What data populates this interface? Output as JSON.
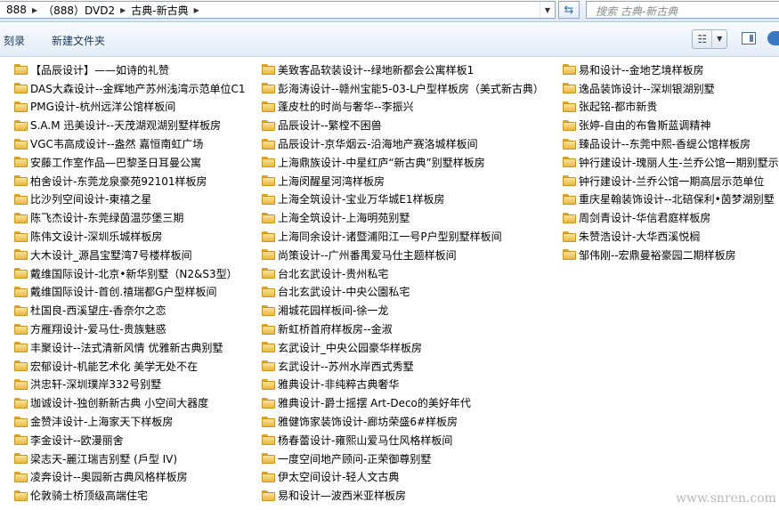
{
  "address": {
    "crumbs": [
      "888",
      "（888）DVD2",
      "古典-新古典"
    ],
    "search_placeholder": "搜索 古典-新古典"
  },
  "toolbar": {
    "burn_label": "刻录",
    "new_folder_label": "新建文件夹"
  },
  "watermark": "www.snren.com",
  "columns": [
    [
      "【品辰设计】——如诗的礼赞",
      "DAS大森设计--金辉地产苏州浅湾示范单位C1",
      "PMG设计-杭州远洋公馆样板间",
      "S.A.M 迅美设计--天茂湖观湖别墅样板房",
      "VGC韦高成设计--盎然 嘉恒南虹广场",
      "安藤工作室作品—巴黎圣日耳曼公寓",
      "柏舍设计-东莞龙泉豪苑92101样板房",
      "比沙列空间设计-東禧之星",
      "陈飞杰设计-东莞绿茵温莎堡三期",
      "陈伟文设计-深圳乐城样板房",
      "大木设计_源昌宝墅湾7号楼样板间",
      "戴维国际设计-北京•新华别墅（N2&S3型）",
      "戴维国际设计-首创.禧瑞都G户型样板间",
      "杜国良-西溪望庄-香奈尔之恋",
      "方雁翔设计-爱马仕-贵族魅惑",
      "丰聚设计--法式清新风情 优雅新古典别墅",
      "宏郁设计-机能艺术化 美学无处不在",
      "洪忠轩-深圳璞岸332号别墅",
      "珈诚设计-独创新新古典 小空间大器度",
      "金赞沣设计-上海家天下样板房",
      "李金设计--欧漫丽舍",
      "梁志天-麗江瑞吉别墅 (戶型 IV)",
      "凌奔设计--奥园新古典风格样板房",
      "伦敦骑士桥顶级高端住宅"
    ],
    [
      "美致客品软装设计--绿地新都会公寓样板1",
      "彭海涛设计--赣州宝能5-03-L户型样板房（美式新古典）",
      "蓬皮杜的时尚与奢华--李振兴",
      "品辰设计--繁樘不困兽",
      "品辰设计-京华烟云-沿海地产赛洛城样板间",
      "上海鼎族设计-中星红庐“新古典”别墅样板房",
      "上海闵醒星河湾样板房",
      "上海全筑设计-宝业万华城E1样板房",
      "上海全筑设计-上海明苑别墅",
      "上海同余设计-诸暨浦阳江一号P户型别墅样板间",
      "尚策设计--广州番禺爱马仕主题样板间",
      "台北玄武设计-贵州私宅",
      "台北玄武设计-中央公園私宅",
      "湘城花园样板间-徐一龙",
      "新虹桥首府样板房--金淑",
      "玄武设计_中央公园豪华样板房",
      "玄武设计--苏州水岸西式秀墅",
      "雅典设计-非纯粹古典奢华",
      "雅典设计-爵士摇摆 Art-Deco的美好年代",
      "雅健饰家装饰设计-廊坊荣盛6#样板房",
      "杨春蕾设计-雍熙山爱马仕风格样板间",
      "一度空间地产顾问-正荣御尊别墅",
      "伊太空间设计-轻人文古典",
      "易和设计—波西米亚样板房"
    ],
    [
      "易和设计--金地艺境样板房",
      "逸品装饰设计--深圳银湖别墅",
      "张起铭-都市新贵",
      "张婷-自由的布鲁斯蓝调精神",
      "臻品设计--东莞中熙-香缇公馆样板房",
      "钟行建设计-瑰丽人生-兰乔公馆一期别墅示",
      "钟行建设计-兰乔公馆一期高层示范单位",
      "重庆星翰装饰设计--北碚保利•茵梦湖别墅",
      "周剑青设计-华信君庭样板房",
      "朱赞浩设计-大华西溪悦榈",
      "邹伟刚--宏鼎曼裕豪园二期样板房"
    ]
  ]
}
